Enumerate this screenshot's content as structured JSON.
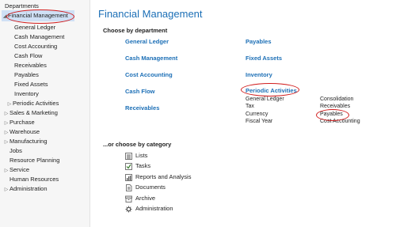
{
  "sidebar": {
    "header": "Departments",
    "selected": "Financial Management",
    "sub_items": [
      "General Ledger",
      "Cash Management",
      "Cost Accounting",
      "Cash Flow",
      "Receivables",
      "Payables",
      "Fixed Assets",
      "Inventory",
      "Periodic Activities"
    ],
    "top_items": [
      "Sales & Marketing",
      "Purchase",
      "Warehouse",
      "Manufacturing",
      "Jobs",
      "Resource Planning",
      "Service",
      "Human Resources",
      "Administration"
    ]
  },
  "main": {
    "title": "Financial Management",
    "choose_by_department": "Choose by department",
    "left_links": [
      "General Ledger",
      "Cash Management",
      "Cost Accounting",
      "Cash Flow",
      "Receivables"
    ],
    "right_links": [
      "Payables",
      "Fixed Assets",
      "Inventory",
      "Periodic Activities"
    ],
    "periodic_sub_left": [
      "General Ledger",
      "Tax",
      "Currency",
      "Fiscal Year"
    ],
    "periodic_sub_right": [
      "Consolidation",
      "Receivables",
      "Payables",
      "Cost Accounting"
    ],
    "choose_by_category": "...or choose by category",
    "categories": [
      "Lists",
      "Tasks",
      "Reports and Analysis",
      "Documents",
      "Archive",
      "Administration"
    ]
  },
  "colors": {
    "accent": "#1c6fb6",
    "highlight_oval": "#d11c1c",
    "selected_bg": "#cfe0f5"
  }
}
